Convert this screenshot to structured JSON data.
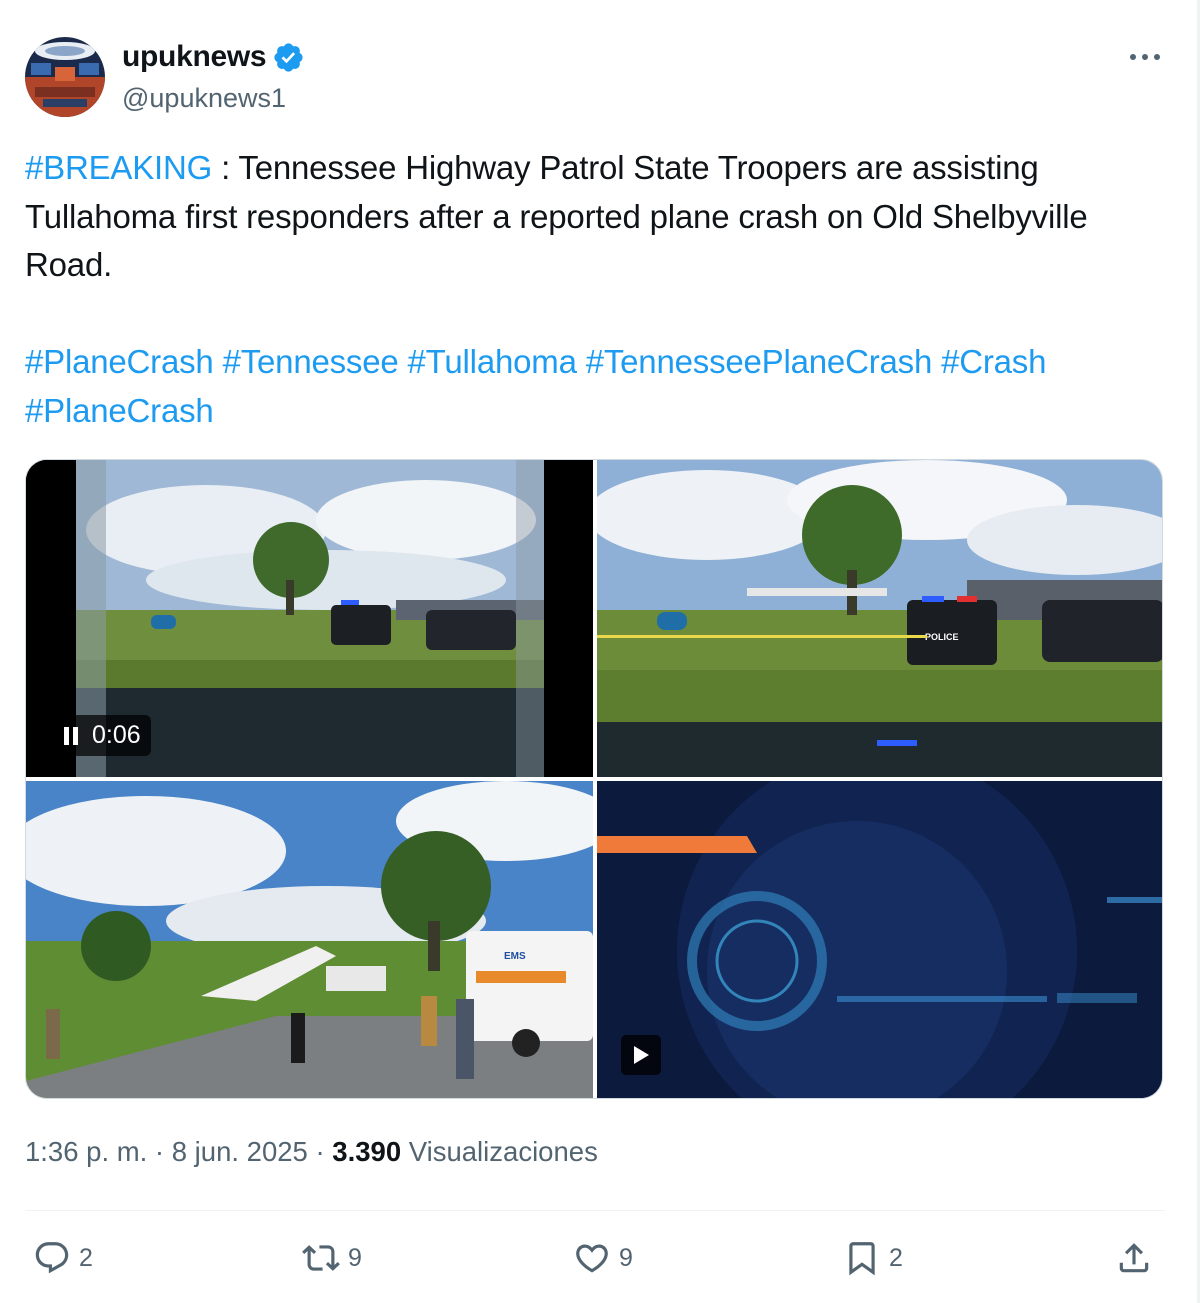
{
  "author": {
    "display_name": "upuknews",
    "handle": "@upuknews1",
    "verified_icon": "verified-badge-icon",
    "more_icon": "more-horizontal-icon"
  },
  "tweet": {
    "hashtag_breaking": "#BREAKING",
    "sentence": " : Tennessee Highway Patrol State Troopers are assisting Tullahoma first responders after a reported plane crash on Old Shelbyville Road.",
    "hashtags": [
      "#PlaneCrash",
      "#Tennessee",
      "#Tullahoma",
      "#TennesseePlaneCrash",
      "#Crash",
      "#PlaneCrash"
    ]
  },
  "media": {
    "video_time": "0:06",
    "badge_text": "POLICE",
    "ems_text": "EMS"
  },
  "meta": {
    "time": "1:36 p. m.",
    "sep1": " · ",
    "date": "8 jun. 2025",
    "sep2": " · ",
    "views": "3.390",
    "views_label": " Visualizaciones"
  },
  "actions": {
    "reply_count": "2",
    "retweet_count": "9",
    "like_count": "9",
    "bookmark_count": "2"
  },
  "colors": {
    "link": "#1d9bf0",
    "text": "#0f1419",
    "secondary": "#536471"
  }
}
